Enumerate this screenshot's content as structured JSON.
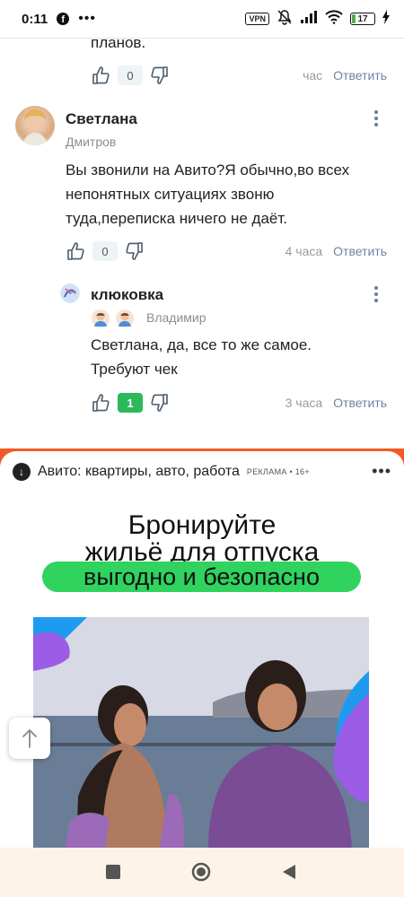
{
  "status_bar": {
    "time": "0:11",
    "vpn": "VPN",
    "battery_level": "17",
    "battery_fraction": 0.17
  },
  "comments": [
    {
      "text_tail": "планов.",
      "likes": "0",
      "time": "час",
      "reply": "Ответить"
    },
    {
      "author": "Светлана",
      "location": "Дмитров",
      "text": "Вы звонили на Авито?Я обычно,во всех непонятных ситуациях звоню туда,переписка ничего не даёт.",
      "text_lines": [
        "Вы звонили на Авито?Я обычно,во всех",
        "непонятных ситуациях звоню",
        "туда,переписка ничего не даёт."
      ],
      "likes": "0",
      "time": "4 часа",
      "reply": "Ответить"
    },
    {
      "author": "клюковка",
      "location": "Владимир",
      "text_lines": [
        "Светлана, да, все то же самое.",
        "Требуют чек"
      ],
      "likes": "1",
      "time": "3 часа",
      "reply": "Ответить"
    }
  ],
  "ad": {
    "title": "Авито: квартиры, авто, работа",
    "label": "РЕКЛАМА • 16+",
    "headline_line1": "Бронируйте",
    "headline_line2": "жильё для отпуска",
    "headline_highlight": "выгодно и безопасно",
    "accent_color": "#f15a24",
    "highlight_color": "#2fd35e"
  },
  "colors": {
    "reply_link": "#6a86a3",
    "positive_vote": "#2db85b"
  }
}
